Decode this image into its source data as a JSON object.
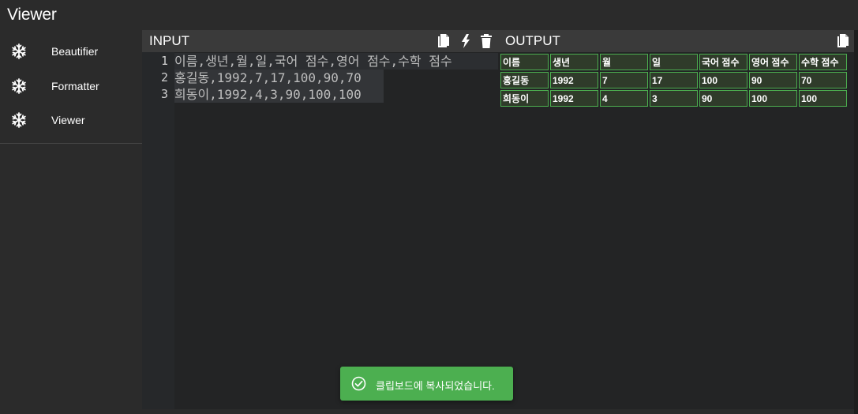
{
  "app": {
    "title": "Viewer"
  },
  "sidebar": {
    "items": [
      {
        "label": "Beautifier",
        "icon": "snowflake-icon"
      },
      {
        "label": "Formatter",
        "icon": "snowflake-icon"
      },
      {
        "label": "Viewer",
        "icon": "snowflake-icon"
      }
    ]
  },
  "input_panel": {
    "title": "INPUT",
    "icons": [
      "copy-icon",
      "flash-icon",
      "trash-icon"
    ],
    "line_numbers": [
      "1",
      "2",
      "3"
    ],
    "lines": [
      "이름,생년,월,일,국어 점수,영어 점수,수학 점수",
      "홍길동,1992,7,17,100,90,70",
      "희동이,1992,4,3,90,100,100"
    ]
  },
  "output_panel": {
    "title": "OUTPUT",
    "icons": [
      "copy-icon"
    ],
    "table": {
      "rows": [
        [
          "이름",
          "생년",
          "월",
          "일",
          "국어 점수",
          "영어 점수",
          "수학 점수"
        ],
        [
          "홍길동",
          "1992",
          "7",
          "17",
          "100",
          "90",
          "70"
        ],
        [
          "희동이",
          "1992",
          "4",
          "3",
          "90",
          "100",
          "100"
        ]
      ]
    }
  },
  "toast": {
    "message": "클립보드에 복사되었습니다.",
    "icon": "check-circle-icon"
  },
  "colors": {
    "background": "#2b2b2b",
    "panel_header": "#3a3a3a",
    "editor_bg": "#232425",
    "table_border": "#4caf50",
    "table_cell_bg": "#2f3b2a",
    "toast_bg": "#4caf50"
  }
}
